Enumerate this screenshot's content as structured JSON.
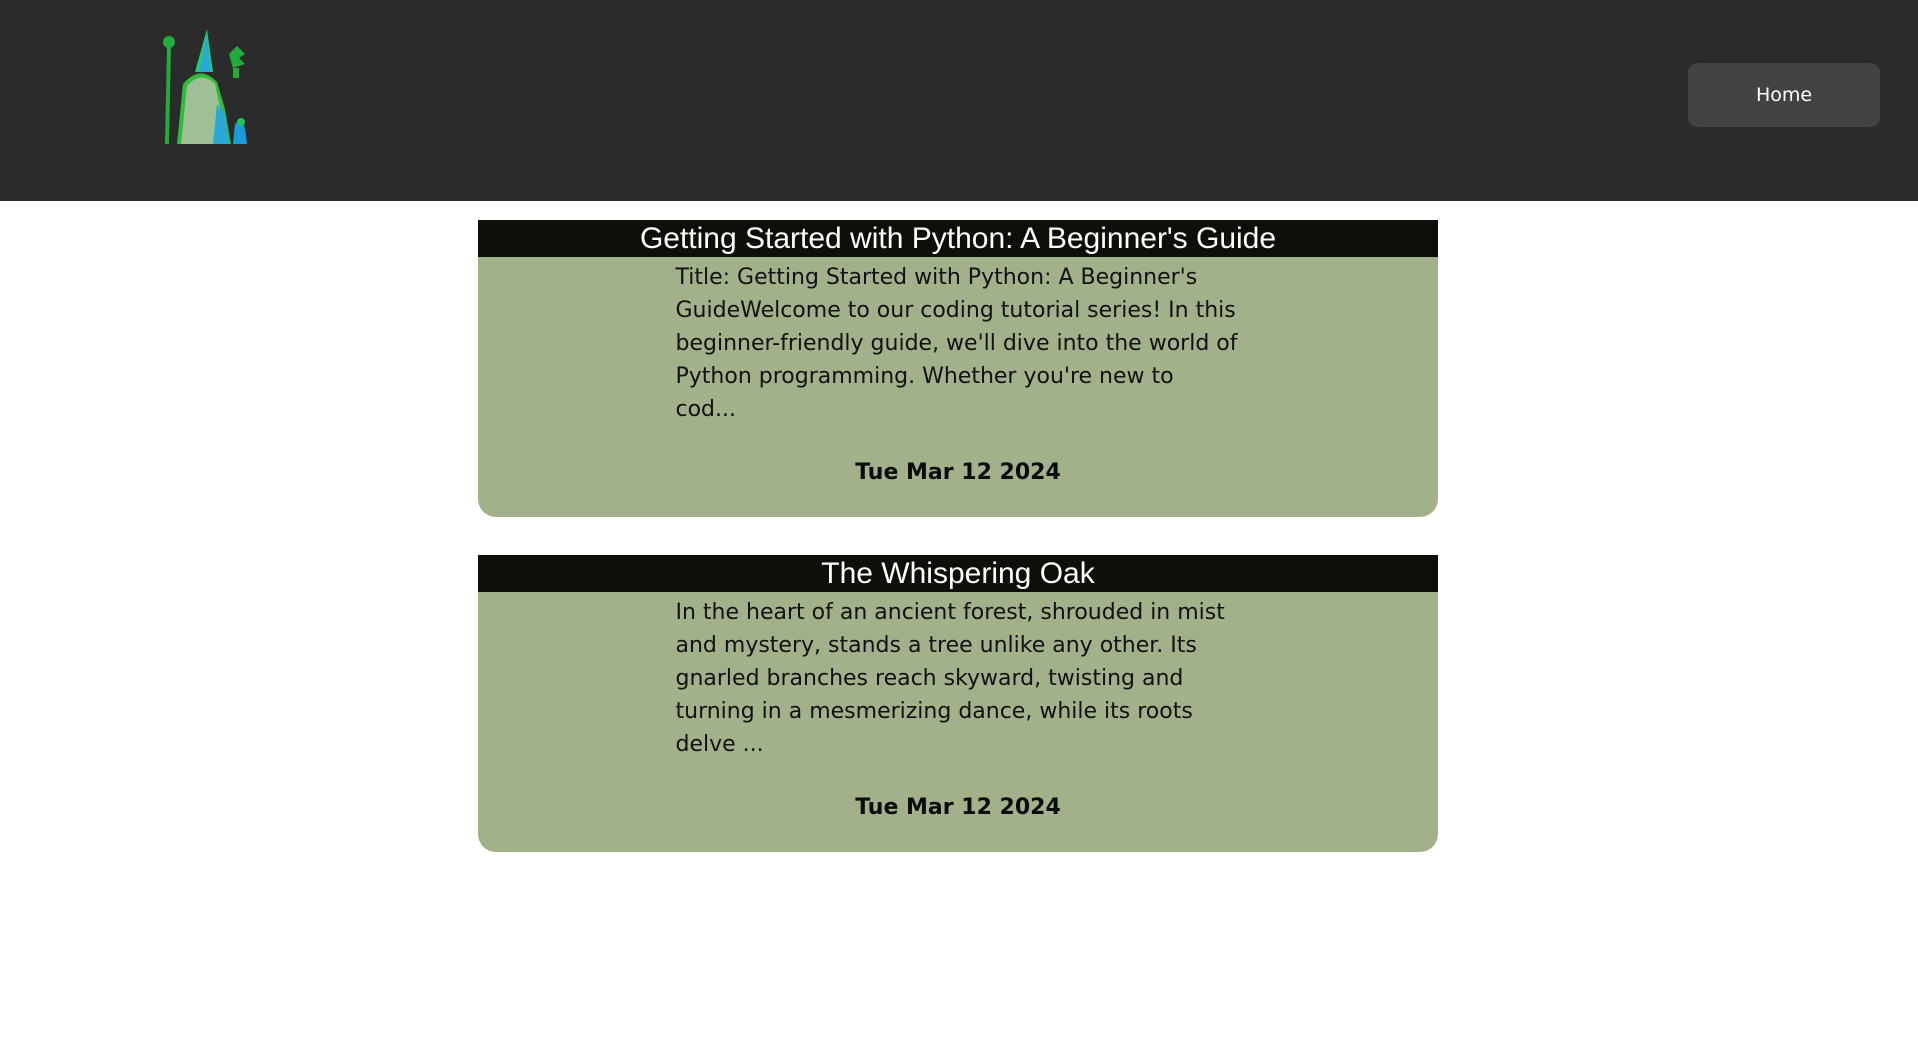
{
  "header": {
    "logo_icon": "wizard-logo-icon",
    "home_label": "Home"
  },
  "posts": [
    {
      "title": "Getting Started with Python: A Beginner's Guide",
      "excerpt": "Title: Getting Started with Python: A Beginner's GuideWelcome to our coding tutorial series! In this beginner-friendly guide, we'll dive into the world of Python programming. Whether you're new to cod...",
      "date": "Tue Mar 12 2024"
    },
    {
      "title": "The Whispering Oak",
      "excerpt": "In the heart of an ancient forest, shrouded in mist and mystery, stands a tree unlike any other. Its gnarled branches reach skyward, twisting and turning in a mesmerizing dance, while its roots delve ...",
      "date": "Tue Mar 12 2024"
    }
  ],
  "colors": {
    "header_bg": "#2b2b2b",
    "button_bg": "#424242",
    "card_bg": "#a2b189",
    "card_title_bg": "#0f0f0a"
  }
}
